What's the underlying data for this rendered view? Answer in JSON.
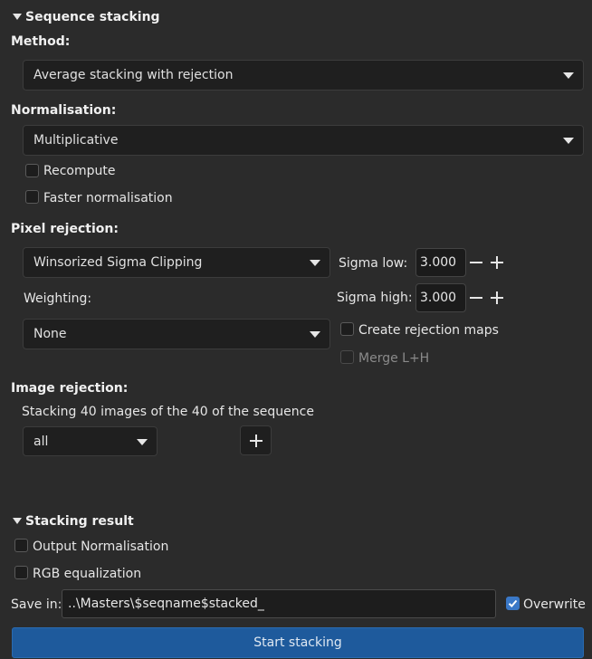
{
  "sequence_stacking": {
    "title": "Sequence stacking",
    "method_label": "Method:",
    "method_value": "Average stacking with rejection",
    "normalisation_label": "Normalisation:",
    "normalisation_value": "Multiplicative",
    "recompute_label": "Recompute",
    "recompute_checked": false,
    "faster_norm_label": "Faster normalisation",
    "faster_norm_checked": false,
    "pixel_rejection_label": "Pixel rejection:",
    "pixel_rejection_value": "Winsorized Sigma Clipping",
    "sigma_low_label": "Sigma low:",
    "sigma_low_value": "3.000",
    "sigma_high_label": "Sigma high:",
    "sigma_high_value": "3.000",
    "weighting_label": "Weighting:",
    "weighting_value": "None",
    "create_rejection_maps_label": "Create rejection maps",
    "create_rejection_maps_checked": false,
    "merge_lh_label": "Merge L+H",
    "merge_lh_checked": false,
    "image_rejection_label": "Image rejection:",
    "image_rejection_info": "Stacking 40 images of the 40 of the sequence",
    "image_rejection_value": "all"
  },
  "stacking_result": {
    "title": "Stacking result",
    "output_normalisation_label": "Output Normalisation",
    "output_normalisation_checked": false,
    "rgb_equalization_label": "RGB equalization",
    "rgb_equalization_checked": false,
    "save_in_label": "Save in:",
    "save_in_value": "..\\Masters\\$seqname$stacked_",
    "overwrite_label": "Overwrite",
    "overwrite_checked": true
  },
  "start_button_label": "Start stacking",
  "colors": {
    "background": "#2b2b2b",
    "accent": "#3a78c7",
    "primary_button": "#1e5a9c"
  }
}
